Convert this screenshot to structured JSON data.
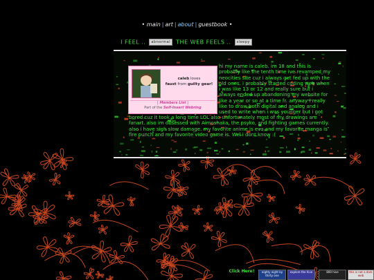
{
  "nav": {
    "items": [
      {
        "label": "main"
      },
      {
        "label": "art"
      },
      {
        "label": "about"
      },
      {
        "label": "guestbook"
      }
    ],
    "left_mark": "•",
    "right_mark": "•",
    "separator": "|"
  },
  "feels": {
    "prefix": "I FEEL ..",
    "tag1": "abnormal",
    "middle": "THE WEB FEELS ..",
    "tag2": "sleepy"
  },
  "card": {
    "intro_name": "caleb",
    "intro_loves": "loves",
    "intro_subject": "faust",
    "intro_from": "from",
    "intro_game": "guilty gear!",
    "members_link": "| Members List |",
    "part_of": "Part of the",
    "webring": "Self-Insert Webring"
  },
  "bio": {
    "part1": "hi my name is caleb. im 18 and this is probably like the tenth time ive revamped my neocities site cuz i always get fed up with the old ones. i probably started coding web when i was like 13 or 12 and really sure but i always ended up abandoning my website for like a year or so at a time fr. anyway i really like to draw both digital and analog and i used to write when i was younger but i got",
    "part2": "bored cuz it took a long time LOL also unfortunately most of my drawings are fanart. also im obsessed with Aimoshaka, the psyko, and fighting games currently. also i have sigh slow damage. my favorite anime is eva and my favorite manga is fire punch and my favorite video game is. Wel i dont know :("
  },
  "footer": {
    "click_here": "Click Here!",
    "buttons": [
      {
        "label": "eighty eight by thirty one"
      },
      {
        "label": "explore the hive"
      },
      {
        "label": "800 hive"
      },
      {
        "label": "this is not a dark web"
      }
    ]
  },
  "colors": {
    "accent_green": "#33e833",
    "card_pink": "#ffd9ec",
    "flower_orange": "#e0542a"
  }
}
